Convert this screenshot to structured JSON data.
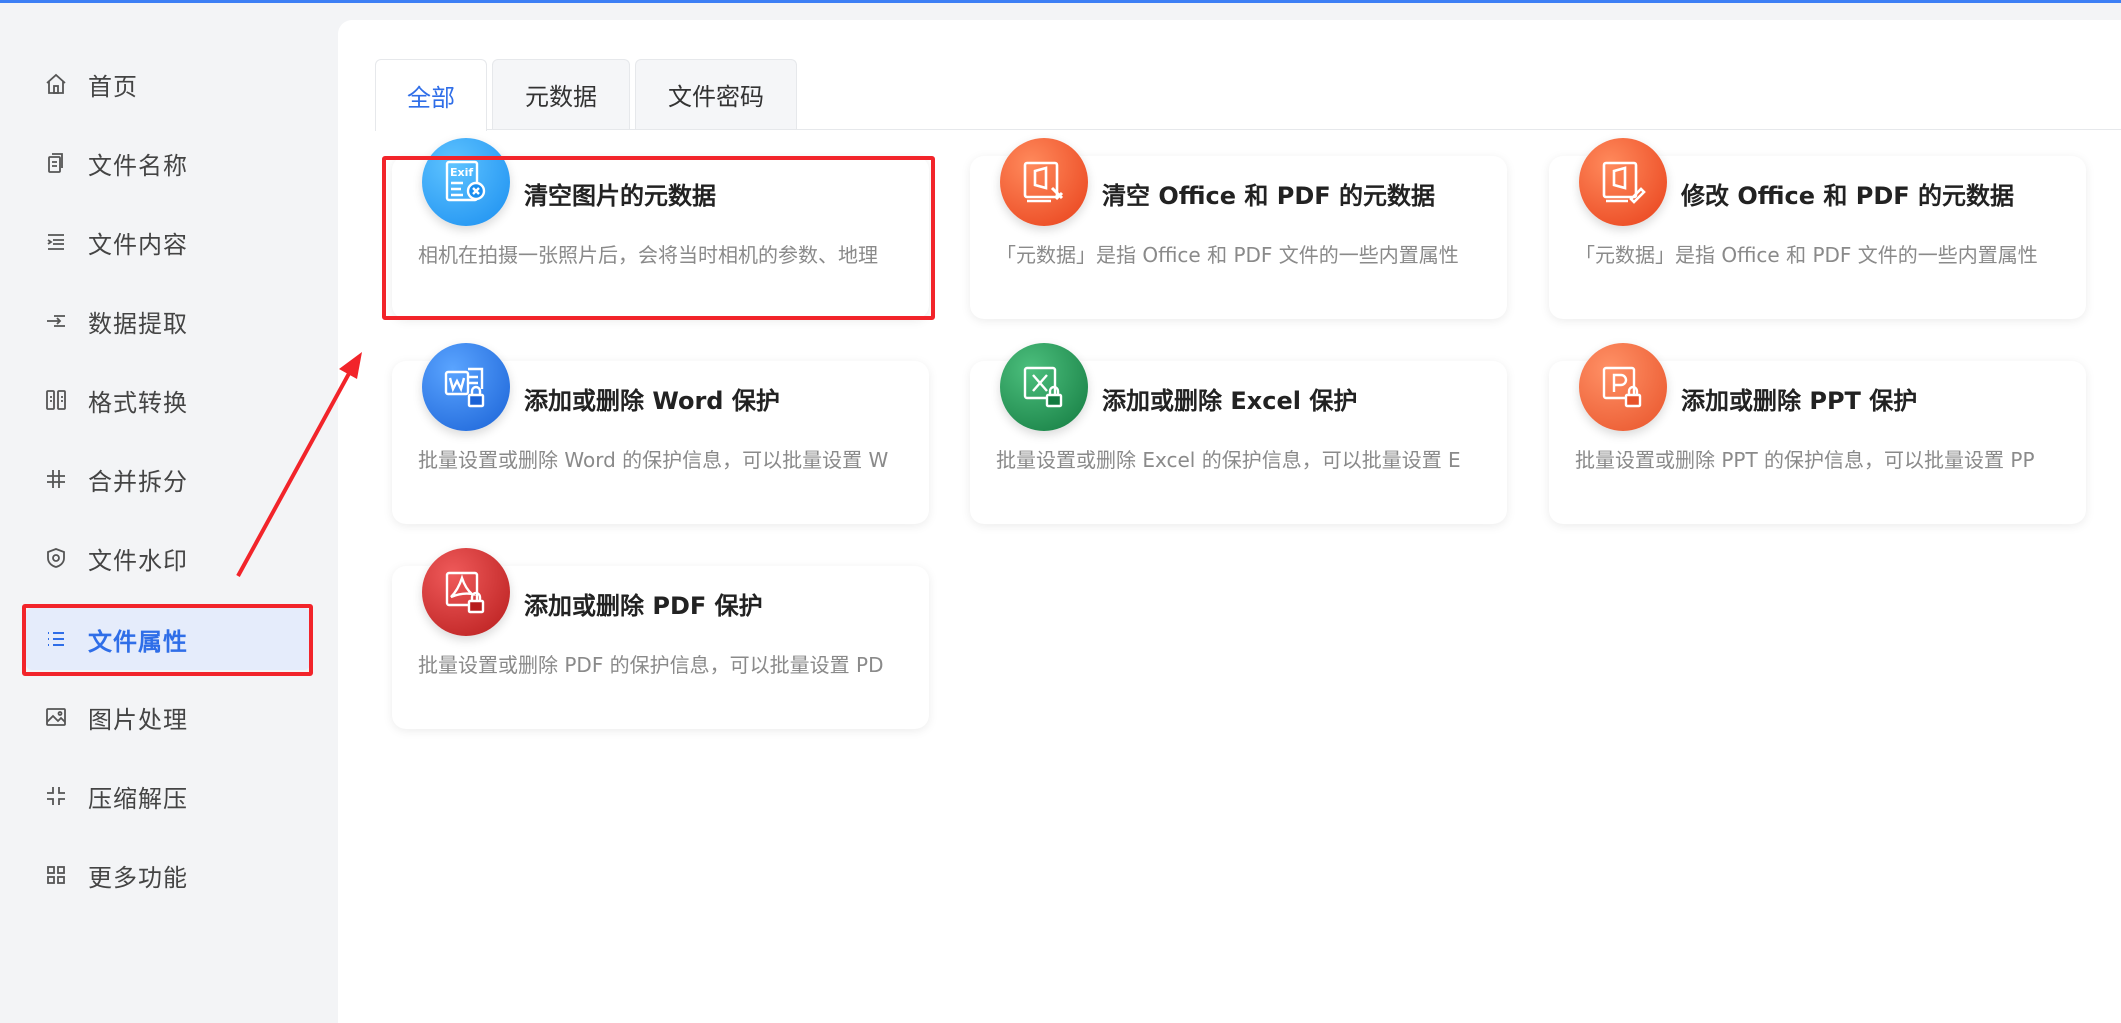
{
  "sidebar": {
    "items": [
      {
        "label": "首页",
        "icon": "home-icon"
      },
      {
        "label": "文件名称",
        "icon": "file-copy-icon"
      },
      {
        "label": "文件内容",
        "icon": "text-list-icon"
      },
      {
        "label": "数据提取",
        "icon": "extract-icon"
      },
      {
        "label": "格式转换",
        "icon": "convert-icon"
      },
      {
        "label": "合并拆分",
        "icon": "hash-icon"
      },
      {
        "label": "文件水印",
        "icon": "shield-icon"
      },
      {
        "label": "文件属性",
        "icon": "list-icon",
        "active": true
      },
      {
        "label": "图片处理",
        "icon": "image-icon"
      },
      {
        "label": "压缩解压",
        "icon": "compress-icon"
      },
      {
        "label": "更多功能",
        "icon": "grid-icon"
      }
    ]
  },
  "tabs": [
    {
      "label": "全部",
      "active": true
    },
    {
      "label": "元数据"
    },
    {
      "label": "文件密码"
    }
  ],
  "cards": [
    {
      "title": "清空图片的元数据",
      "desc": "相机在拍摄一张照片后，会将当时相机的参数、地理",
      "icon": "exif-icon",
      "color": "#2196f3"
    },
    {
      "title": "清空 Office 和 PDF 的元数据",
      "desc": "「元数据」是指 Office 和 PDF 文件的一些内置属性",
      "icon": "office-clean-icon",
      "color": "#f4511e"
    },
    {
      "title": "修改 Office 和 PDF 的元数据",
      "desc": "「元数据」是指 Office 和 PDF 文件的一些内置属性",
      "icon": "office-edit-icon",
      "color": "#f4511e"
    },
    {
      "title": "添加或删除 Word 保护",
      "desc": "批量设置或删除 Word 的保护信息，可以批量设置 W",
      "icon": "word-lock-icon",
      "color": "#1e6fd9"
    },
    {
      "title": "添加或删除 Excel 保护",
      "desc": "批量设置或删除 Excel 的保护信息，可以批量设置 E",
      "icon": "excel-lock-icon",
      "color": "#1e8e4e"
    },
    {
      "title": "添加或删除 PPT 保护",
      "desc": "批量设置或删除 PPT 的保护信息，可以批量设置 PP",
      "icon": "ppt-lock-icon",
      "color": "#f06a3d"
    },
    {
      "title": "添加或删除 PDF 保护",
      "desc": "批量设置或删除 PDF 的保护信息，可以批量设置 PD",
      "icon": "pdf-lock-icon",
      "color": "#d32f2f"
    }
  ],
  "colors": {
    "accent": "#2f6ee8",
    "highlight": "#f2242a",
    "top_bar": "#3d7ff5"
  }
}
